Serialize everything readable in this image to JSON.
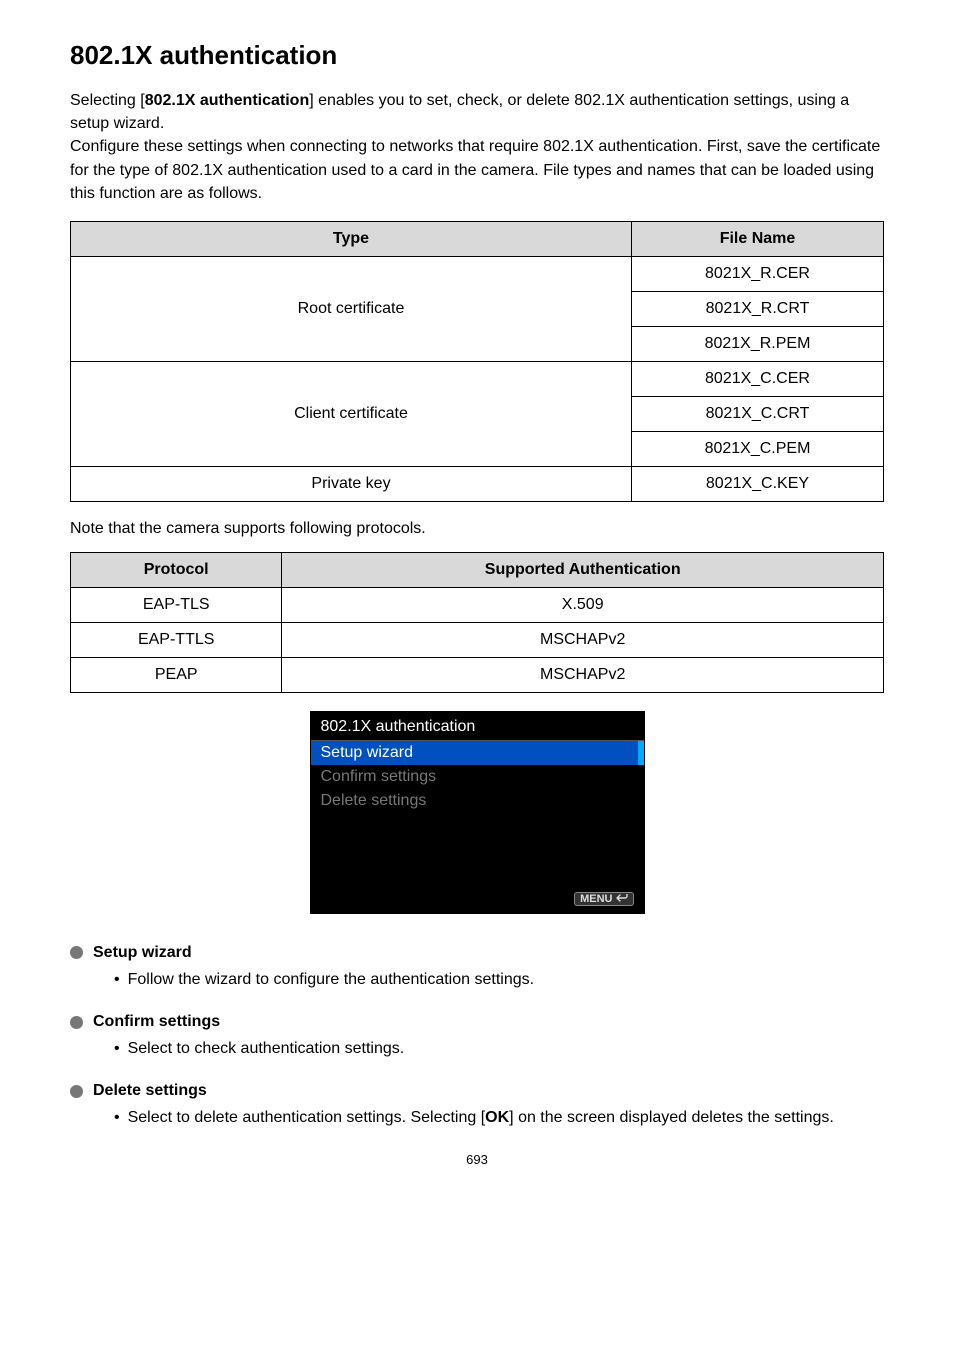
{
  "heading": "802.1X authentication",
  "intro_parts": {
    "p1a": "Selecting [",
    "p1b": "802.1X authentication",
    "p1c": "] enables you to set, check, or delete 802.1X authentication settings, using a setup wizard.",
    "p2": "Configure these settings when connecting to networks that require 802.1X authentication. First, save the certificate for the type of 802.1X authentication used to a card in the camera. File types and names that can be loaded using this function are as follows."
  },
  "table1": {
    "headers": {
      "type": "Type",
      "filename": "File Name"
    },
    "rows": [
      {
        "type": "Root certificate",
        "files": [
          "8021X_R.CER",
          "8021X_R.CRT",
          "8021X_R.PEM"
        ]
      },
      {
        "type": "Client certificate",
        "files": [
          "8021X_C.CER",
          "8021X_C.CRT",
          "8021X_C.PEM"
        ]
      },
      {
        "type": "Private key",
        "files": [
          "8021X_C.KEY"
        ]
      }
    ]
  },
  "note": "Note that the camera supports following protocols.",
  "table2": {
    "headers": {
      "protocol": "Protocol",
      "auth": "Supported Authentication"
    },
    "rows": [
      {
        "protocol": "EAP-TLS",
        "auth": "X.509"
      },
      {
        "protocol": "EAP-TTLS",
        "auth": "MSCHAPv2"
      },
      {
        "protocol": "PEAP",
        "auth": "MSCHAPv2"
      }
    ]
  },
  "menu": {
    "title": "802.1X authentication",
    "items": [
      {
        "label": "Setup wizard",
        "selected": true
      },
      {
        "label": "Confirm settings",
        "selected": false
      },
      {
        "label": "Delete settings",
        "selected": false
      }
    ],
    "footer_label": "MENU"
  },
  "sections": [
    {
      "title": "Setup wizard",
      "text": "Follow the wizard to configure the authentication settings."
    },
    {
      "title": "Confirm settings",
      "text": "Select to check authentication settings."
    },
    {
      "title": "Delete settings",
      "text_prefix": "Select to delete authentication settings. Selecting [",
      "text_bold": "OK",
      "text_suffix": "] on the screen displayed deletes the settings."
    }
  ],
  "page_number": "693"
}
